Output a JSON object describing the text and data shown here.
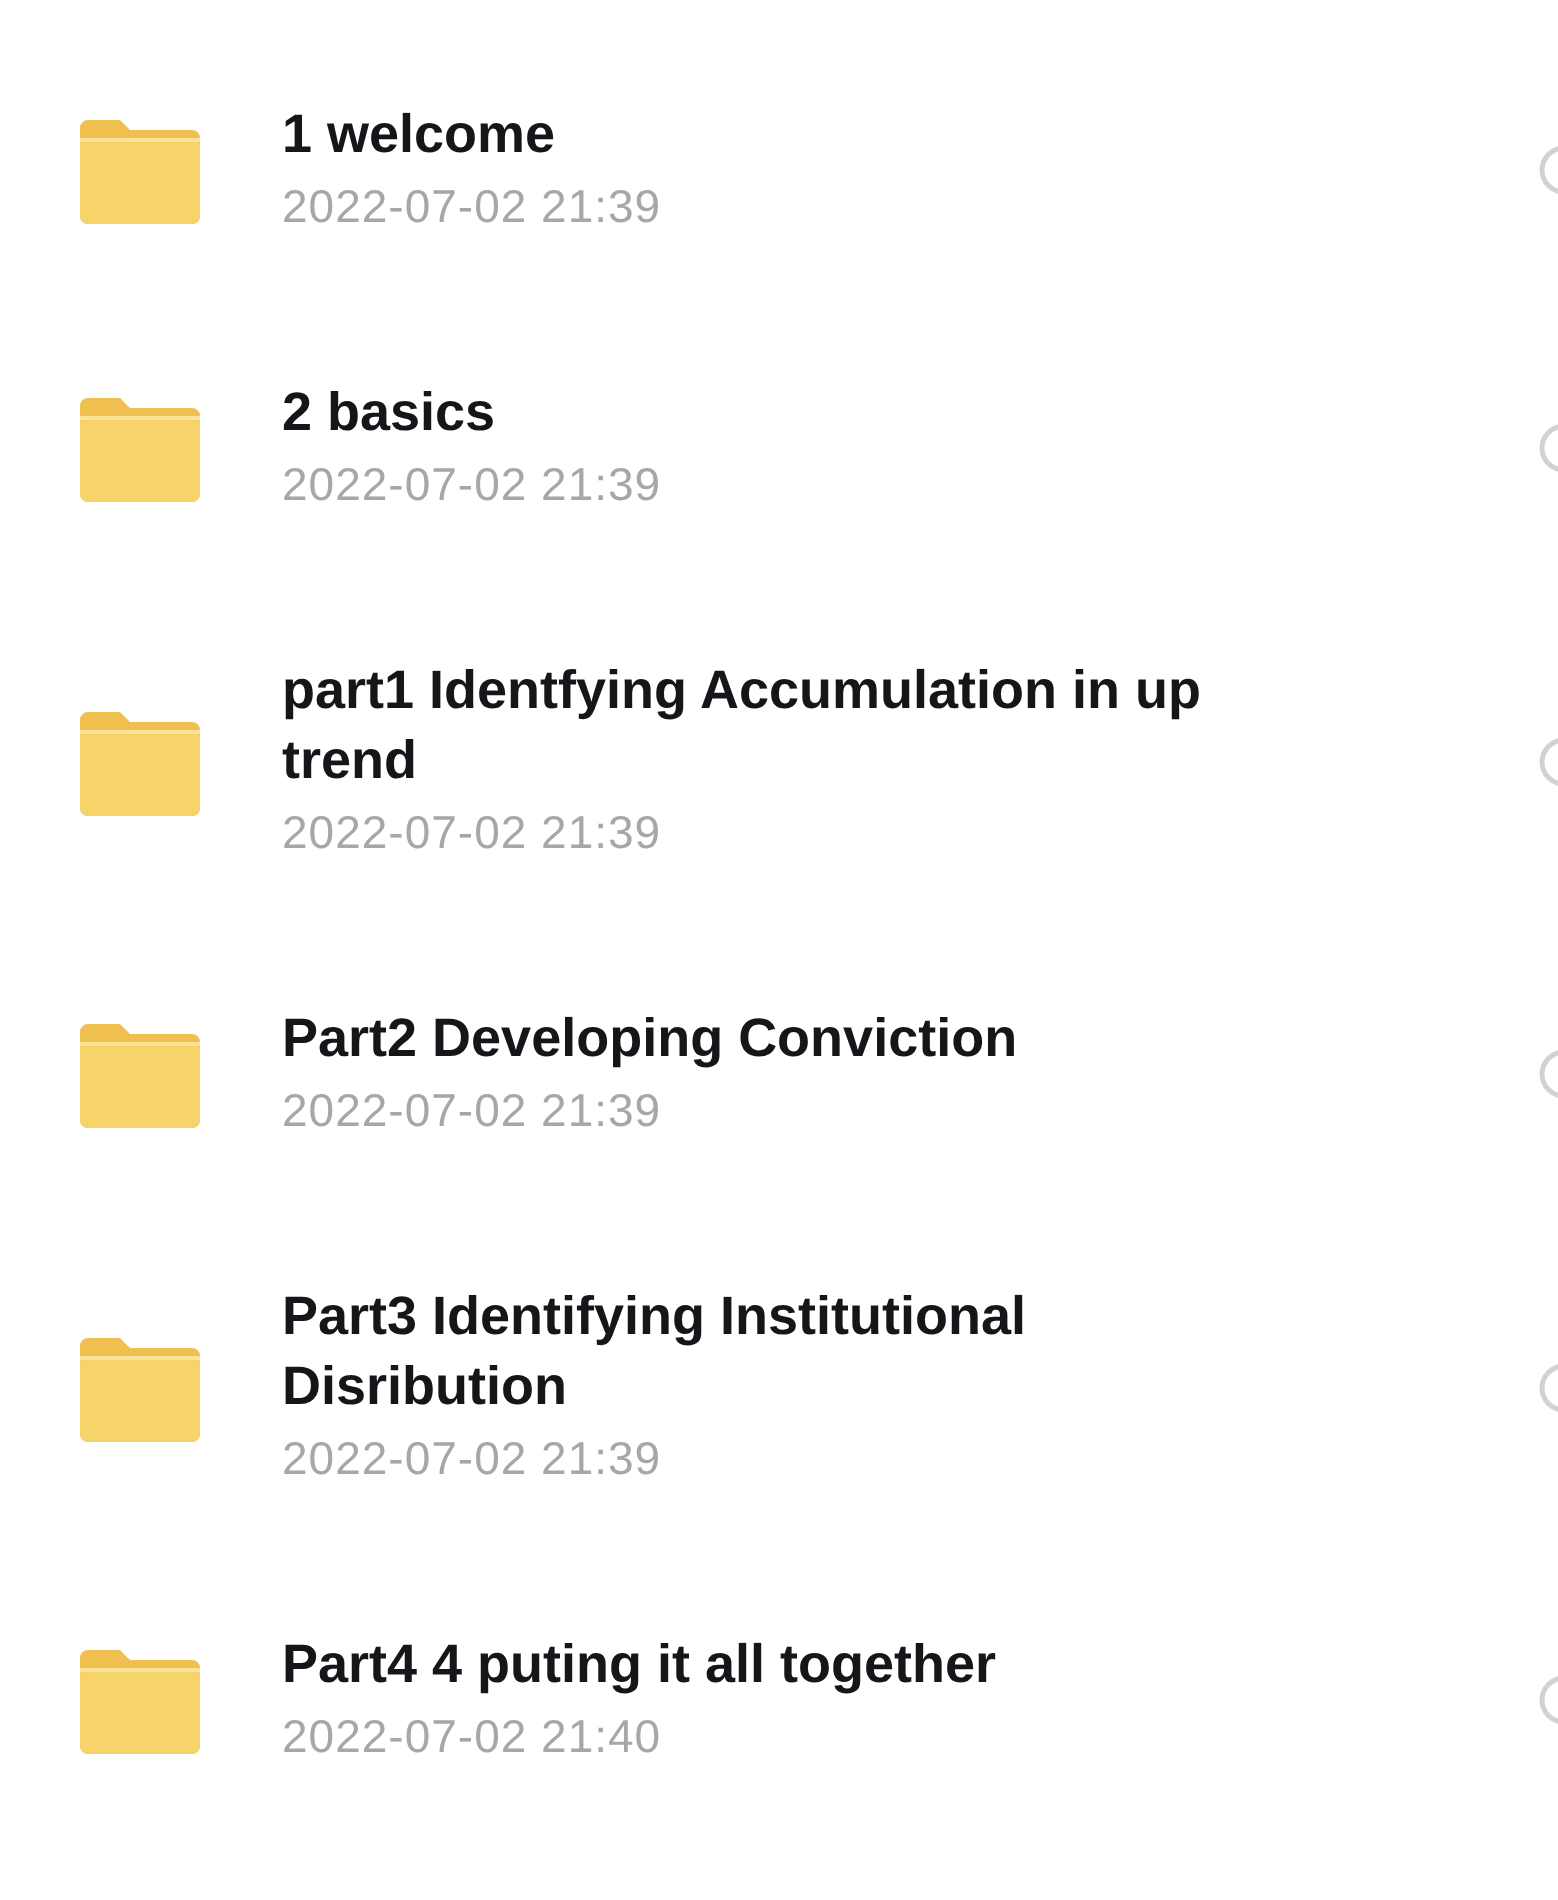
{
  "files": [
    {
      "name": "1 welcome",
      "date": "2022-07-02 21:39",
      "selected": false
    },
    {
      "name": "2 basics",
      "date": "2022-07-02 21:39",
      "selected": false
    },
    {
      "name": "part1 Identfying Accumulation in up trend",
      "date": "2022-07-02 21:39",
      "selected": false
    },
    {
      "name": "Part2 Developing Conviction",
      "date": "2022-07-02 21:39",
      "selected": false
    },
    {
      "name": "Part3 Identifying Institutional Disribution",
      "date": "2022-07-02 21:39",
      "selected": false
    },
    {
      "name": "Part4 4 puting it all together",
      "date": "2022-07-02 21:40",
      "selected": false
    }
  ]
}
